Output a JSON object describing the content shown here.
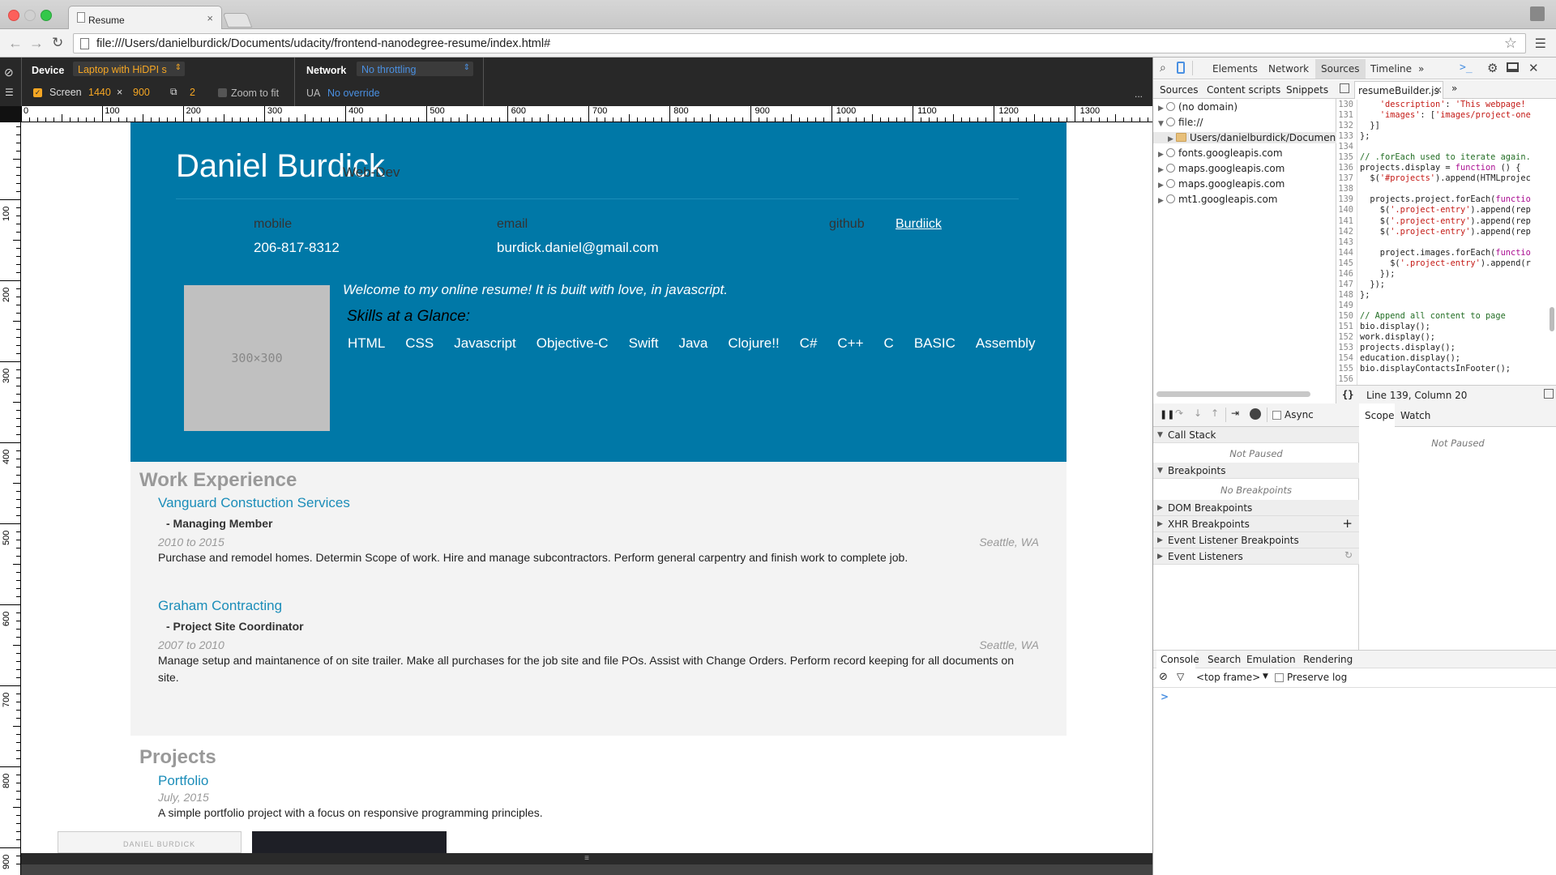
{
  "browser": {
    "tab_title": "Resume",
    "tab_close": "×",
    "url": "file:///Users/danielburdick/Documents/udacity/frontend-nanodegree-resume/index.html#"
  },
  "device_bar": {
    "device_label": "Device",
    "device_value": "Laptop with HiDPI s",
    "network_label": "Network",
    "network_value": "No throttling",
    "screen_label": "Screen",
    "screen_w": "1440",
    "screen_x": "×",
    "screen_h": "900",
    "dpr": "2",
    "zoom_label": "Zoom to fit",
    "ua_label": "UA",
    "ua_value": "No override",
    "more": "..."
  },
  "ruler": {
    "h_labels": [
      "0",
      "100",
      "200",
      "300",
      "400",
      "500",
      "600",
      "700",
      "800",
      "900",
      "1000",
      "1100",
      "1200",
      "1300"
    ],
    "v_labels": [
      "100",
      "200",
      "300",
      "400",
      "500",
      "600",
      "700",
      "800",
      "900"
    ]
  },
  "resume": {
    "name": "Daniel Burdick",
    "role": "Web-Dev",
    "contacts": {
      "mobile_label": "mobile",
      "mobile_value": "206-817-8312",
      "email_label": "email",
      "email_value": "burdick.daniel@gmail.com",
      "github_label": "github",
      "github_value": "Burdiick"
    },
    "bio_pic_text": "300×300",
    "welcome": "Welcome to my online resume! It is built with love, in javascript.",
    "skills_heading": "Skills at a Glance:",
    "skills": [
      "HTML",
      "CSS",
      "Javascript",
      "Objective-C",
      "Swift",
      "Java",
      "Clojure!!",
      "C#",
      "C++",
      "C",
      "BASIC",
      "Assembly"
    ],
    "work_heading": "Work Experience",
    "jobs": [
      {
        "employer": "Vanguard Constuction Services",
        "title": "- Managing Member",
        "dates": "2010 to 2015",
        "location": "Seattle, WA",
        "description": "Purchase and remodel homes. Determin Scope of work. Hire and manage subcontractors. Perform general carpentry and finish work to complete job."
      },
      {
        "employer": "Graham Contracting",
        "title": "- Project Site Coordinator",
        "dates": "2007 to 2010",
        "location": "Seattle, WA",
        "description": "Manage setup and maintanence of on site trailer. Make all purchases for the job site and file POs. Assist with Change Orders. Perform record keeping for all documents on site."
      }
    ],
    "projects_heading": "Projects",
    "project": {
      "title": "Portfolio",
      "dates": "July, 2015",
      "description": "A simple portfolio project with a focus on responsive programming principles.",
      "thumb_text": "DANIEL BURDICK"
    }
  },
  "devtools": {
    "tabs": [
      "Elements",
      "Network",
      "Sources",
      "Timeline",
      "»"
    ],
    "active_tab": "Sources",
    "source_tabs": [
      "Sources",
      "Content scripts",
      "Snippets"
    ],
    "tree": [
      {
        "label": "(no domain)",
        "indent": 0,
        "arrow": "▶"
      },
      {
        "label": "file://",
        "indent": 0,
        "arrow": "▼"
      },
      {
        "label": "Users/danielburdick/Documen",
        "indent": 1,
        "arrow": "▶"
      },
      {
        "label": "fonts.googleapis.com",
        "indent": 0,
        "arrow": "▶"
      },
      {
        "label": "maps.googleapis.com",
        "indent": 0,
        "arrow": "▶"
      },
      {
        "label": "maps.googleapis.com",
        "indent": 0,
        "arrow": "▶"
      },
      {
        "label": "mt1.googleapis.com",
        "indent": 0,
        "arrow": "▶"
      }
    ],
    "open_file": "resumeBuilder.js",
    "code_lines": [
      {
        "n": "130",
        "html": "    <span class='cstr'>'description'</span>: <span class='cstr'>'This webpage!</span>"
      },
      {
        "n": "131",
        "html": "    <span class='cstr'>'images'</span>: [<span class='cstr'>'images/project-one</span>"
      },
      {
        "n": "132",
        "html": "  }]"
      },
      {
        "n": "133",
        "html": "};"
      },
      {
        "n": "134",
        "html": ""
      },
      {
        "n": "135",
        "html": "<span class='ccm'>// .forEach used to iterate again.</span>"
      },
      {
        "n": "136",
        "html": "projects.display = <span class='ckw'>function</span> () {"
      },
      {
        "n": "137",
        "html": "  $(<span class='cstr'>'#projects'</span>).append(HTMLprojec"
      },
      {
        "n": "138",
        "html": ""
      },
      {
        "n": "139",
        "html": "  projects.project.forEach(<span class='ckw'>functio</span>"
      },
      {
        "n": "140",
        "html": "    $(<span class='cstr'>'.project-entry'</span>).append(rep"
      },
      {
        "n": "141",
        "html": "    $(<span class='cstr'>'.project-entry'</span>).append(rep"
      },
      {
        "n": "142",
        "html": "    $(<span class='cstr'>'.project-entry'</span>).append(rep"
      },
      {
        "n": "143",
        "html": ""
      },
      {
        "n": "144",
        "html": "    project.images.forEach(<span class='ckw'>functio</span>"
      },
      {
        "n": "145",
        "html": "      $(<span class='cstr'>'.project-entry'</span>).append(r"
      },
      {
        "n": "146",
        "html": "    });"
      },
      {
        "n": "147",
        "html": "  });"
      },
      {
        "n": "148",
        "html": "};"
      },
      {
        "n": "149",
        "html": ""
      },
      {
        "n": "150",
        "html": "<span class='ccm'>// Append all content to page</span>"
      },
      {
        "n": "151",
        "html": "bio.display();"
      },
      {
        "n": "152",
        "html": "work.display();"
      },
      {
        "n": "153",
        "html": "projects.display();"
      },
      {
        "n": "154",
        "html": "education.display();"
      },
      {
        "n": "155",
        "html": "bio.displayContactsInFooter();"
      },
      {
        "n": "156",
        "html": ""
      }
    ],
    "cursor_pos": "Line 139, Column 20",
    "async_label": "Async",
    "panes": [
      "Call Stack",
      "Breakpoints",
      "DOM Breakpoints",
      "XHR Breakpoints",
      "Event Listener Breakpoints",
      "Event Listeners"
    ],
    "not_paused": "Not Paused",
    "no_breakpoints": "No Breakpoints",
    "scope_tabs": [
      "Scope",
      "Watch"
    ],
    "console_tabs": [
      "Console",
      "Search",
      "Emulation",
      "Rendering"
    ],
    "frame": "<top frame>",
    "preserve_log": "Preserve log",
    "prompt": ">"
  }
}
